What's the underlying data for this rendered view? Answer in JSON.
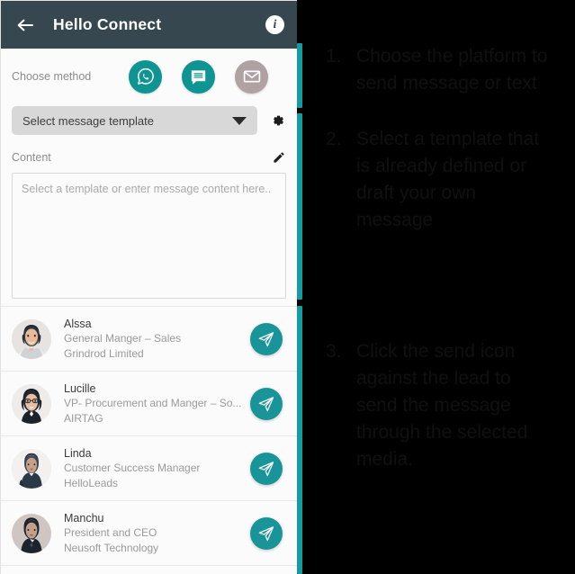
{
  "appbar": {
    "title": "Hello Connect",
    "back_icon": "back-arrow-icon",
    "info_icon": "info-icon",
    "info_glyph": "i"
  },
  "method": {
    "label": "Choose method",
    "options": [
      {
        "name": "whatsapp",
        "icon": "whatsapp-icon",
        "state": "enabled"
      },
      {
        "name": "sms",
        "icon": "chat-bubble-icon",
        "state": "enabled"
      },
      {
        "name": "email",
        "icon": "envelope-icon",
        "state": "disabled"
      }
    ]
  },
  "template": {
    "selected": "Select message template",
    "caret_icon": "chevron-down-icon",
    "settings_icon": "gear-icon"
  },
  "content": {
    "label": "Content",
    "edit_icon": "pencil-icon",
    "placeholder": "Select a template or enter message content here..",
    "value": ""
  },
  "contacts": [
    {
      "name": "Alssa",
      "title": "General Manger – Sales",
      "company": "Grindrod Limited",
      "send_icon": "send-icon"
    },
    {
      "name": "Lucille",
      "title": "VP- Procurement and Manger – So...",
      "company": "AIRTAG",
      "send_icon": "send-icon"
    },
    {
      "name": "Linda",
      "title": "Customer Success Manager",
      "company": "HelloLeads",
      "send_icon": "send-icon"
    },
    {
      "name": "Manchu",
      "title": "President and CEO",
      "company": "Neusoft Technology",
      "send_icon": "send-icon"
    }
  ],
  "instructions": [
    {
      "number": "1.",
      "text": "Choose the platform to send message or text"
    },
    {
      "number": "2.",
      "text": "Select a template that is already defined or draft your own message"
    },
    {
      "number": "3.",
      "text": "Click the send icon against the lead to send the message through the selected media."
    }
  ],
  "colors": {
    "appbar": "#37474f",
    "accent_teal": "#0f9494",
    "send_teal": "#19959a",
    "bar_teal": "#159ba0",
    "disabled_mauve": "#b0a2a2",
    "overlay": "#000000"
  }
}
